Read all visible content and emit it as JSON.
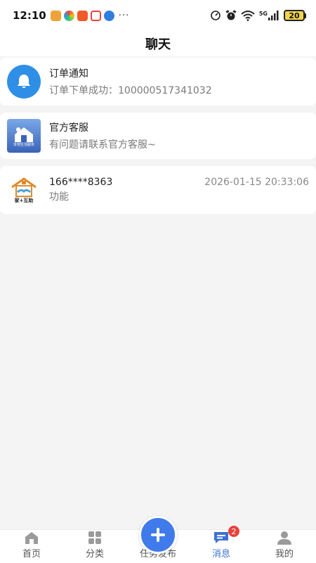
{
  "status_bar": {
    "time": "12:10",
    "more": "···",
    "network": "5G",
    "battery_level": "20"
  },
  "header": {
    "title": "聊天"
  },
  "chats": [
    {
      "name": "订单通知",
      "preview": "订单下单成功：100000517341032",
      "time": "",
      "avatar_icon": "bell-icon"
    },
    {
      "name": "官方客服",
      "preview": "有问题请联系官方客服~",
      "time": "",
      "avatar_icon": "local-life-service-logo",
      "avatar_caption": "本地生活服务"
    },
    {
      "name": "166****8363",
      "preview": "功能",
      "time": "2026-01-15 20:33:06",
      "avatar_icon": "house-handshake-logo",
      "avatar_caption": "家+互助"
    }
  ],
  "tab_bar": {
    "tabs": [
      {
        "label": "首页",
        "icon": "home-icon"
      },
      {
        "label": "分类",
        "icon": "grid-icon"
      },
      {
        "label": "任务发布",
        "icon": "plus-icon"
      },
      {
        "label": "消息",
        "icon": "message-icon",
        "badge": "2",
        "active": true
      },
      {
        "label": "我的",
        "icon": "user-icon"
      }
    ]
  },
  "colors": {
    "accent": "#3f7bea",
    "badge": "#e8423b",
    "background": "#f4f4f4"
  }
}
